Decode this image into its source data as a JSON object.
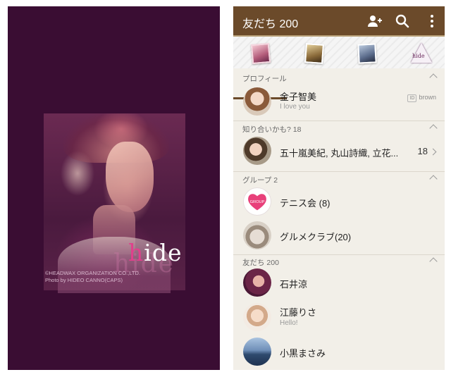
{
  "splash": {
    "logo_first": "h",
    "logo_rest": "ide",
    "shadow_text": "hide",
    "copyright_line1": "©HEADWAX ORGANIZATION CO.,LTD.",
    "copyright_line2": "Photo by HIDEO CANNO(CAPS)"
  },
  "header": {
    "title": "友だち 200",
    "icons": [
      "add-friend-icon",
      "search-icon",
      "more-icon"
    ],
    "bar_color": "#6b4a2a"
  },
  "tabs": {
    "selected_index": 0,
    "logo_label": "hide"
  },
  "sections": {
    "profile": {
      "label": "プロフィール",
      "name": "金子智美",
      "status": "I love you",
      "id_tag": "ID",
      "id_value": "brown"
    },
    "suggest": {
      "label": "知り合いかも? 18",
      "names": "五十嵐美紀, 丸山詩織, 立花...",
      "count": "18"
    },
    "groups": {
      "label": "グループ 2",
      "items": [
        {
          "name": "テニス会 (8)",
          "icon_text": "GROUP"
        },
        {
          "name": "グルメクラブ(20)"
        }
      ]
    },
    "friends": {
      "label": "友だち 200",
      "items": [
        {
          "name": "石井涼",
          "status": ""
        },
        {
          "name": "江藤りさ",
          "status": "Hello!"
        },
        {
          "name": "小黒まさみ",
          "status": ""
        }
      ]
    }
  }
}
